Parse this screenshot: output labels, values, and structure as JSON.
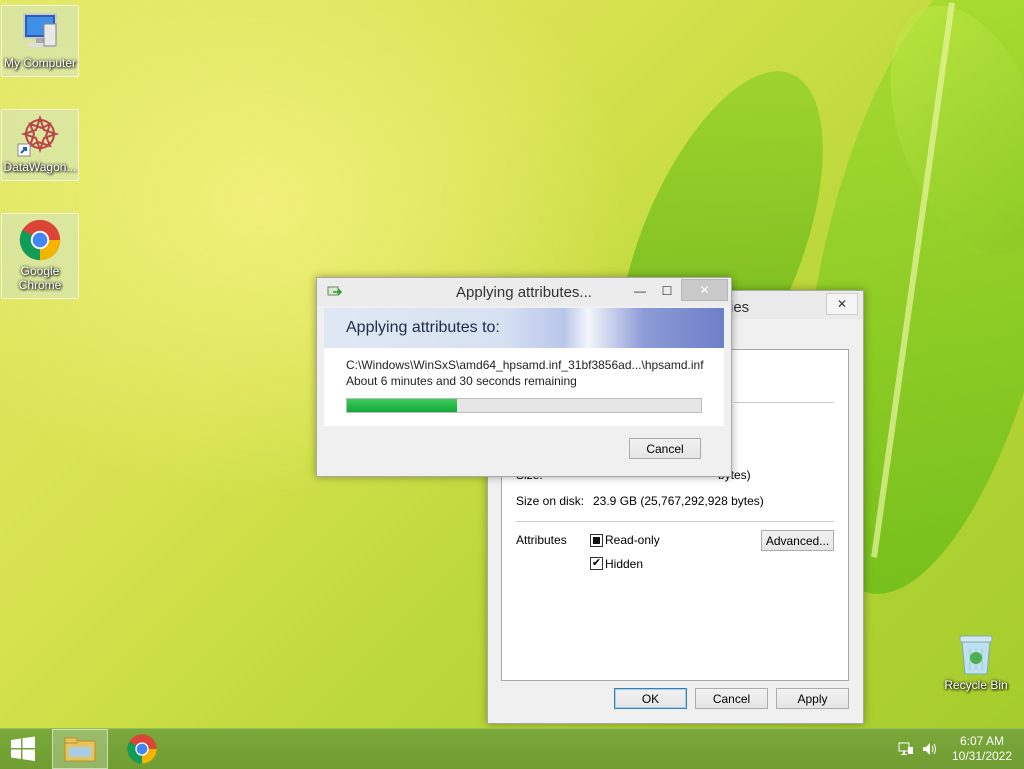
{
  "desktop": {
    "icons": [
      {
        "label": "My Computer"
      },
      {
        "label": "DataWagon..."
      },
      {
        "label": "Google Chrome"
      },
      {
        "label": "Recycle Bin"
      }
    ]
  },
  "properties": {
    "title_fragment": "ies",
    "size_label": "Size:",
    "size_value_fragment": "bytes)",
    "size_on_disk_label": "Size on disk:",
    "size_on_disk_value": "23.9 GB (25,767,292,928 bytes)",
    "attributes_label": "Attributes",
    "readonly_label": "Read-only",
    "hidden_label": "Hidden",
    "advanced_label": "Advanced...",
    "ok_label": "OK",
    "cancel_label": "Cancel",
    "apply_label": "Apply"
  },
  "progress_dialog": {
    "title": "Applying attributes...",
    "heading": "Applying attributes to:",
    "path": "C:\\Windows\\WinSxS\\amd64_hpsamd.inf_31bf3856ad...\\hpsamd.inf",
    "remaining": "About 6 minutes and 30 seconds remaining",
    "progress_fraction": 0.31,
    "cancel_label": "Cancel"
  },
  "taskbar": {
    "time": "6:07 AM",
    "date": "10/31/2022"
  },
  "colors": {
    "progress_fill": "#20b040",
    "taskbar": "#76a436",
    "accent_blue": "#3c7fb1"
  }
}
